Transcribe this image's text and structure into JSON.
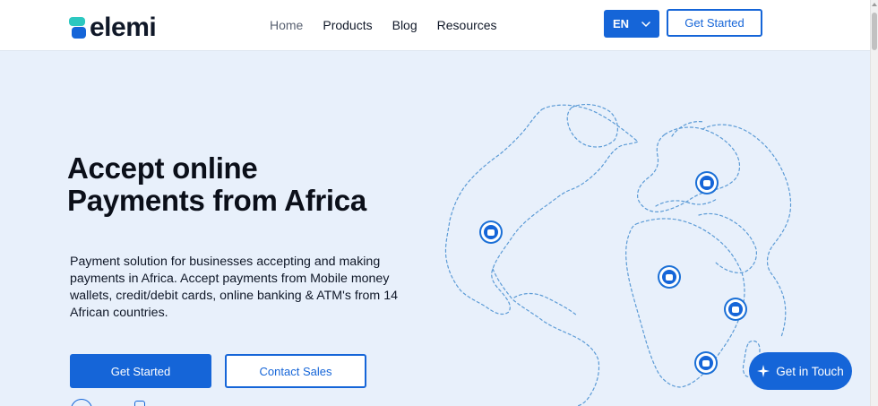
{
  "brand": {
    "name": "elemi"
  },
  "nav": {
    "links": [
      {
        "label": "Home",
        "active": true
      },
      {
        "label": "Products"
      },
      {
        "label": "Blog"
      },
      {
        "label": "Resources"
      }
    ],
    "language": "EN",
    "get_started_label": "Get Started"
  },
  "hero": {
    "title_line1": "Accept online",
    "title_line2": "Payments from Africa",
    "description": "Payment solution for businesses accepting and making payments in Africa. Accept payments from Mobile money wallets, credit/debit cards, online banking & ATM's from 14 African countries.",
    "primary_button": "Get Started",
    "secondary_button": "Contact Sales"
  },
  "chat": {
    "label": "Get in Touch"
  },
  "colors": {
    "accent": "#1565d8",
    "hero_background": "#e8f0fb",
    "logo_teal": "#2cc8c0"
  },
  "icons": {
    "logo": "logo-mark-icon",
    "language_dropdown": "chevron-down-icon",
    "map_pin": "payment-pin-icon",
    "chat": "sparkle-icon"
  }
}
